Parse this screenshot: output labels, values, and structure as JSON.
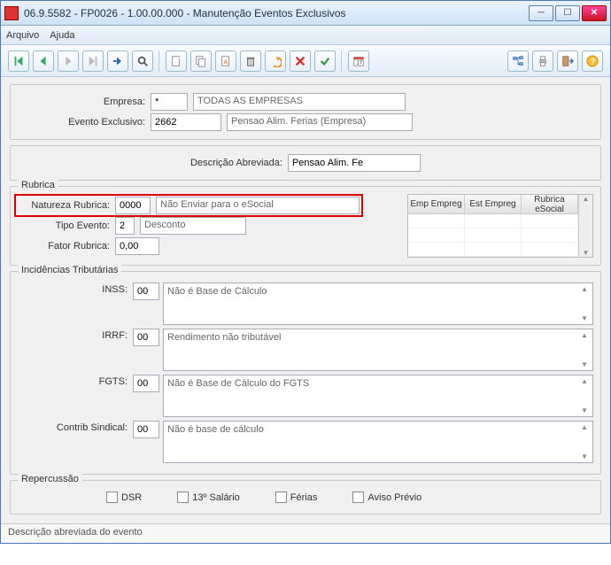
{
  "window": {
    "title": "06.9.5582 - FP0026 - 1.00.00.000 - Manutenção Eventos Exclusivos"
  },
  "menu": {
    "arquivo": "Arquivo",
    "ajuda": "Ajuda"
  },
  "form": {
    "empresa_label": "Empresa:",
    "empresa_code": "*",
    "empresa_desc": "TODAS AS EMPRESAS",
    "evento_label": "Evento Exclusivo:",
    "evento_code": "2662",
    "evento_desc": "Pensao Alim. Ferias (Empresa)",
    "descabrev_label": "Descrição Abreviada:",
    "descabrev_value": "Pensao Alim. Fe"
  },
  "rubrica": {
    "legend": "Rubrica",
    "natureza_label": "Natureza Rubrica:",
    "natureza_code": "0000",
    "natureza_desc": "Não Enviar para o eSocial",
    "tipoevt_label": "Tipo Evento:",
    "tipoevt_code": "2",
    "tipoevt_desc": "Desconto",
    "fator_label": "Fator Rubrica:",
    "fator_value": "0,00",
    "table": {
      "col1": "Emp Empreg",
      "col2": "Est Empreg",
      "col3": "Rubrica eSocial"
    }
  },
  "incidencias": {
    "legend": "Incidências Tributárias",
    "inss_label": "INSS:",
    "inss_code": "00",
    "inss_desc": "Não é Base de Cálculo",
    "irrf_label": "IRRF:",
    "irrf_code": "00",
    "irrf_desc": "Rendimento não tributável",
    "fgts_label": "FGTS:",
    "fgts_code": "00",
    "fgts_desc": "Não é Base de Cálculo do FGTS",
    "sind_label": "Contrib Sindical:",
    "sind_code": "00",
    "sind_desc": "Não é base de cálculo"
  },
  "repercussao": {
    "legend": "Repercussão",
    "dsr": "DSR",
    "decimo": "13º Salário",
    "ferias": "Férias",
    "aviso": "Aviso Prévio"
  },
  "statusbar": "Descrição abreviada do evento"
}
